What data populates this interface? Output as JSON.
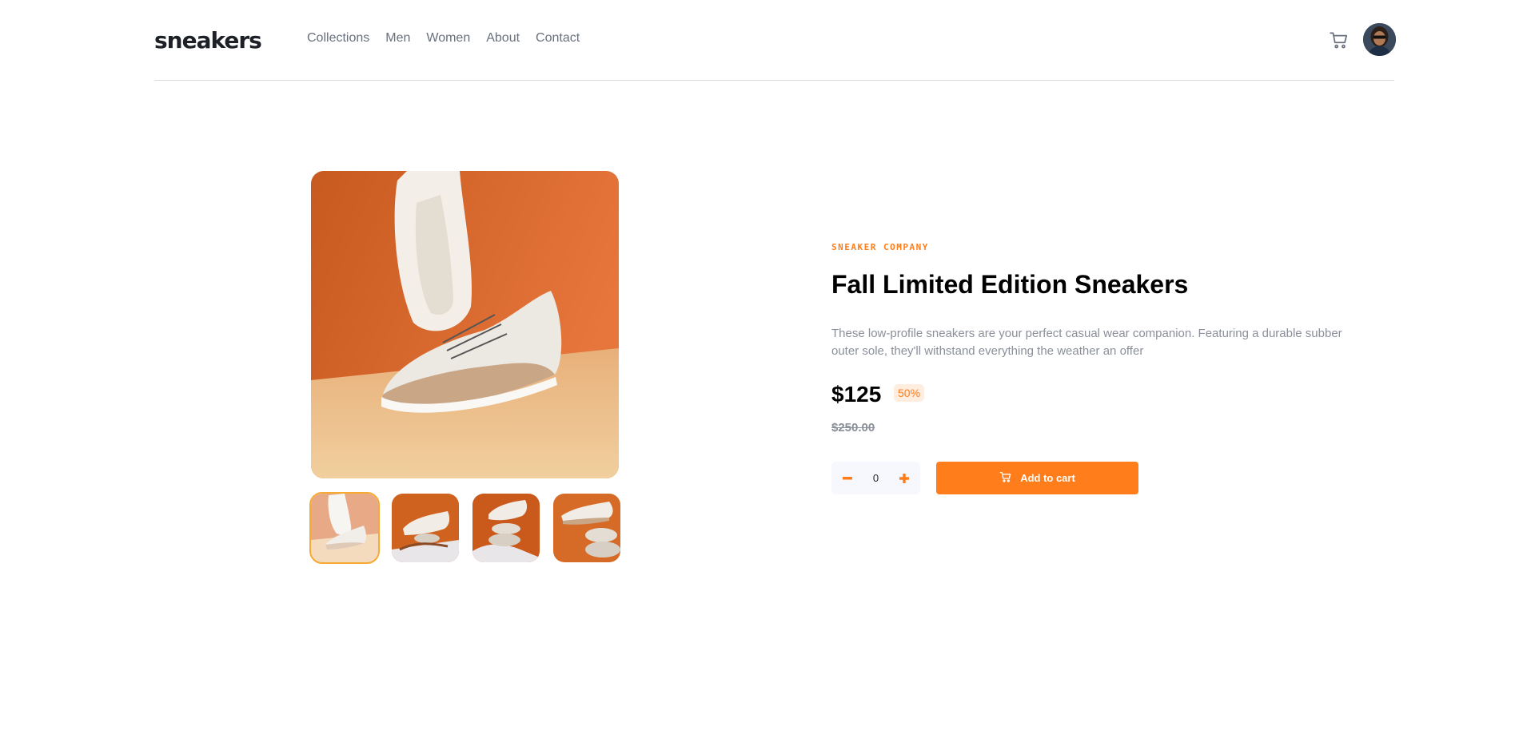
{
  "header": {
    "logo": "sneakers",
    "nav": [
      "Collections",
      "Men",
      "Women",
      "About",
      "Contact"
    ],
    "icons": {
      "cart": "cart-icon",
      "avatar": "avatar"
    }
  },
  "gallery": {
    "thumbnail_count": 4,
    "active_thumbnail": 1
  },
  "product": {
    "company": "SNEAKER COMPANY",
    "title": "Fall Limited Edition Sneakers",
    "description": "These low-profile sneakers are your perfect casual wear companion. Featuring a durable subber outer sole, they'll withstand everything the weather an offer",
    "price": "$125",
    "discount": "50%",
    "old_price": "$250.00",
    "quantity": "0",
    "add_to_cart": "Add to cart"
  },
  "colors": {
    "accent": "#ff7d1a",
    "accent_light": "#ffede0",
    "text_dark": "#1d2026",
    "text_gray": "#69707d"
  }
}
